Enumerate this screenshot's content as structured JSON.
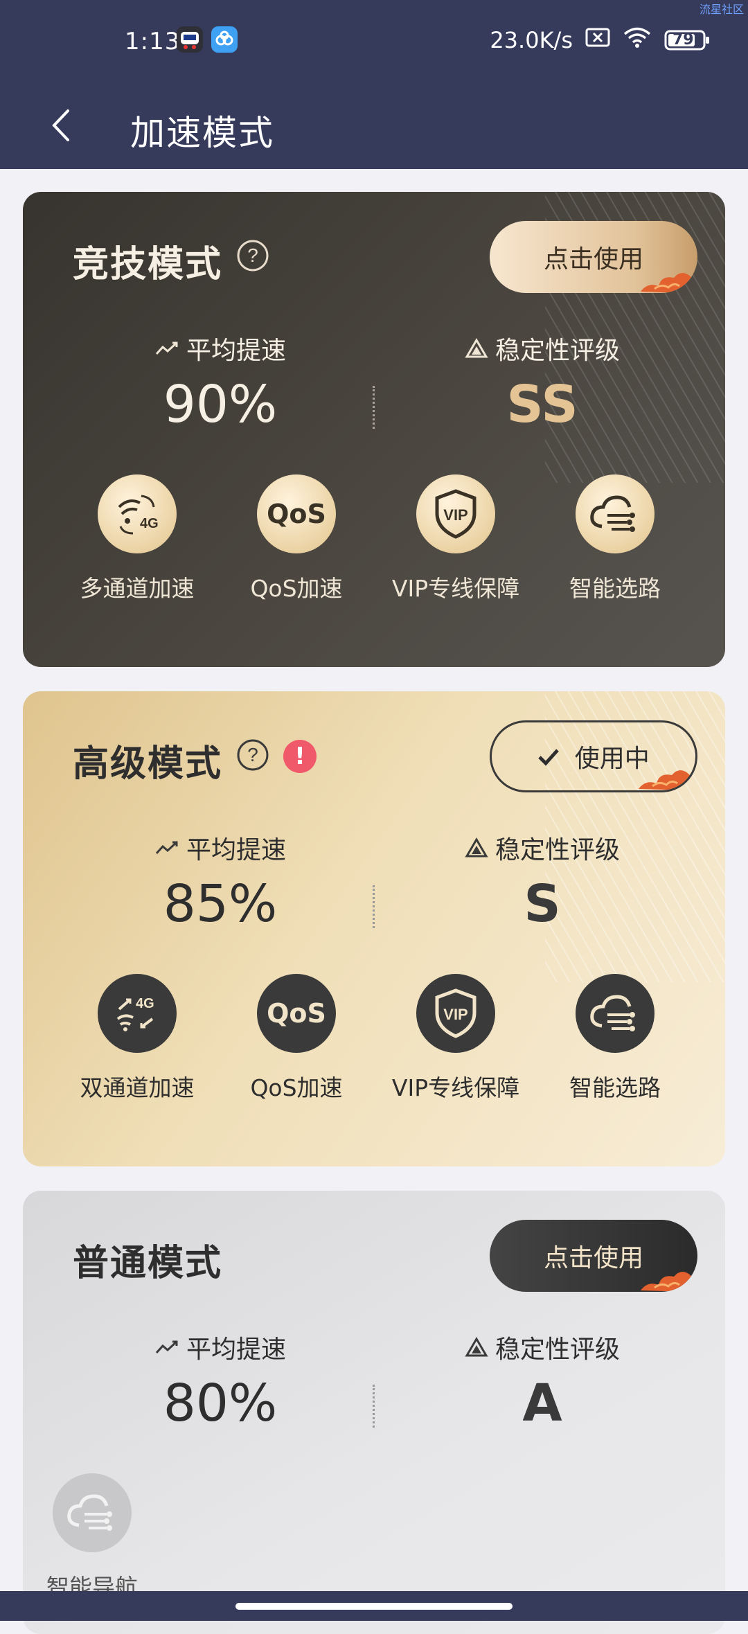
{
  "status_bar": {
    "time": "1:13",
    "network_speed": "23.0K/s",
    "battery": "79",
    "watermark": "流星社区"
  },
  "header": {
    "title": "加速模式"
  },
  "cards": [
    {
      "title": "竞技模式",
      "button_label": "点击使用",
      "speed_label": "平均提速",
      "speed_value": "90%",
      "stability_label": "稳定性评级",
      "stability_value": "SS",
      "features": [
        {
          "label": "多通道加速",
          "icon": "multi-channel-4g-icon"
        },
        {
          "label": "QoS加速",
          "icon": "qos-icon"
        },
        {
          "label": "VIP专线保障",
          "icon": "vip-shield-icon"
        },
        {
          "label": "智能选路",
          "icon": "cloud-routing-icon"
        }
      ]
    },
    {
      "title": "高级模式",
      "button_label": "使用中",
      "speed_label": "平均提速",
      "speed_value": "85%",
      "stability_label": "稳定性评级",
      "stability_value": "S",
      "features": [
        {
          "label": "双通道加速",
          "icon": "dual-channel-4g-icon"
        },
        {
          "label": "QoS加速",
          "icon": "qos-icon"
        },
        {
          "label": "VIP专线保障",
          "icon": "vip-shield-icon"
        },
        {
          "label": "智能选路",
          "icon": "cloud-routing-icon"
        }
      ]
    },
    {
      "title": "普通模式",
      "button_label": "点击使用",
      "speed_label": "平均提速",
      "speed_value": "80%",
      "stability_label": "稳定性评级",
      "stability_value": "A",
      "features": [
        {
          "label": "智能导航",
          "icon": "cloud-routing-icon"
        }
      ]
    }
  ],
  "qos_icon_text": "QoS",
  "vip_icon_text": "VIP",
  "fourg_text": "4G",
  "warn_mark": "!",
  "help_mark": "?"
}
